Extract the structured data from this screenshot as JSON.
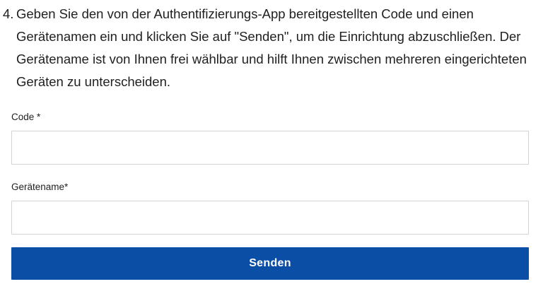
{
  "instruction": {
    "number": "4.",
    "text": "Geben Sie den von der Authentifizierungs-App bereitgestellten Code und einen Gerätenamen ein und klicken Sie auf \"Senden\", um die Einrichtung abzuschließen. Der Gerätename ist von Ihnen frei wählbar und hilft Ihnen zwischen mehreren eingerichteten Geräten zu unterscheiden."
  },
  "form": {
    "code_label": "Code *",
    "code_value": "",
    "device_label": "Gerätename*",
    "device_value": "",
    "submit_label": "Senden"
  },
  "colors": {
    "button_background": "#0a4ea6",
    "button_text": "#ffffff",
    "input_border": "#d3d3d3"
  }
}
